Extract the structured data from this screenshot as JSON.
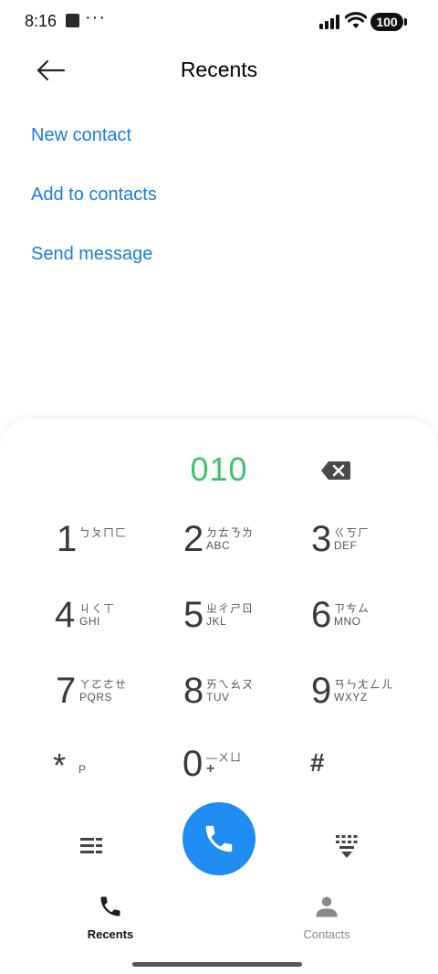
{
  "status": {
    "time": "8:16",
    "dots": "···",
    "battery": "100"
  },
  "header": {
    "title": "Recents"
  },
  "actions": [
    {
      "label": "New contact"
    },
    {
      "label": "Add to contacts"
    },
    {
      "label": "Send message"
    }
  ],
  "dialer": {
    "number": "010",
    "keys": [
      {
        "digit": "1",
        "zhuyin": "ㄅㄆㄇㄈ",
        "letters": ""
      },
      {
        "digit": "2",
        "zhuyin": "ㄉㄊㄋㄌ",
        "letters": "ABC"
      },
      {
        "digit": "3",
        "zhuyin": "ㄍㄎㄏ",
        "letters": "DEF"
      },
      {
        "digit": "4",
        "zhuyin": "ㄐㄑㄒ",
        "letters": "GHI"
      },
      {
        "digit": "5",
        "zhuyin": "ㄓㄔㄕㄖ",
        "letters": "JKL"
      },
      {
        "digit": "6",
        "zhuyin": "ㄗㄘㄙ",
        "letters": "MNO"
      },
      {
        "digit": "7",
        "zhuyin": "ㄚㄛㄜㄝ",
        "letters": "PQRS"
      },
      {
        "digit": "8",
        "zhuyin": "ㄞㄟㄠㄡ",
        "letters": "TUV"
      },
      {
        "digit": "9",
        "zhuyin": "ㄢㄣㄤㄥㄦ",
        "letters": "WXYZ"
      },
      {
        "digit": "*",
        "zhuyin": "",
        "letters": "P"
      },
      {
        "digit": "0",
        "zhuyin": "—ㄨㄩ",
        "letters": "+"
      },
      {
        "digit": "#",
        "zhuyin": "",
        "letters": ""
      }
    ]
  },
  "nav": {
    "tabs": [
      {
        "label": "Recents",
        "active": true
      },
      {
        "label": "Contacts",
        "active": false
      }
    ]
  },
  "colors": {
    "accent": "#1f8cf2",
    "link": "#1a7de0",
    "number": "#3bc36a"
  }
}
